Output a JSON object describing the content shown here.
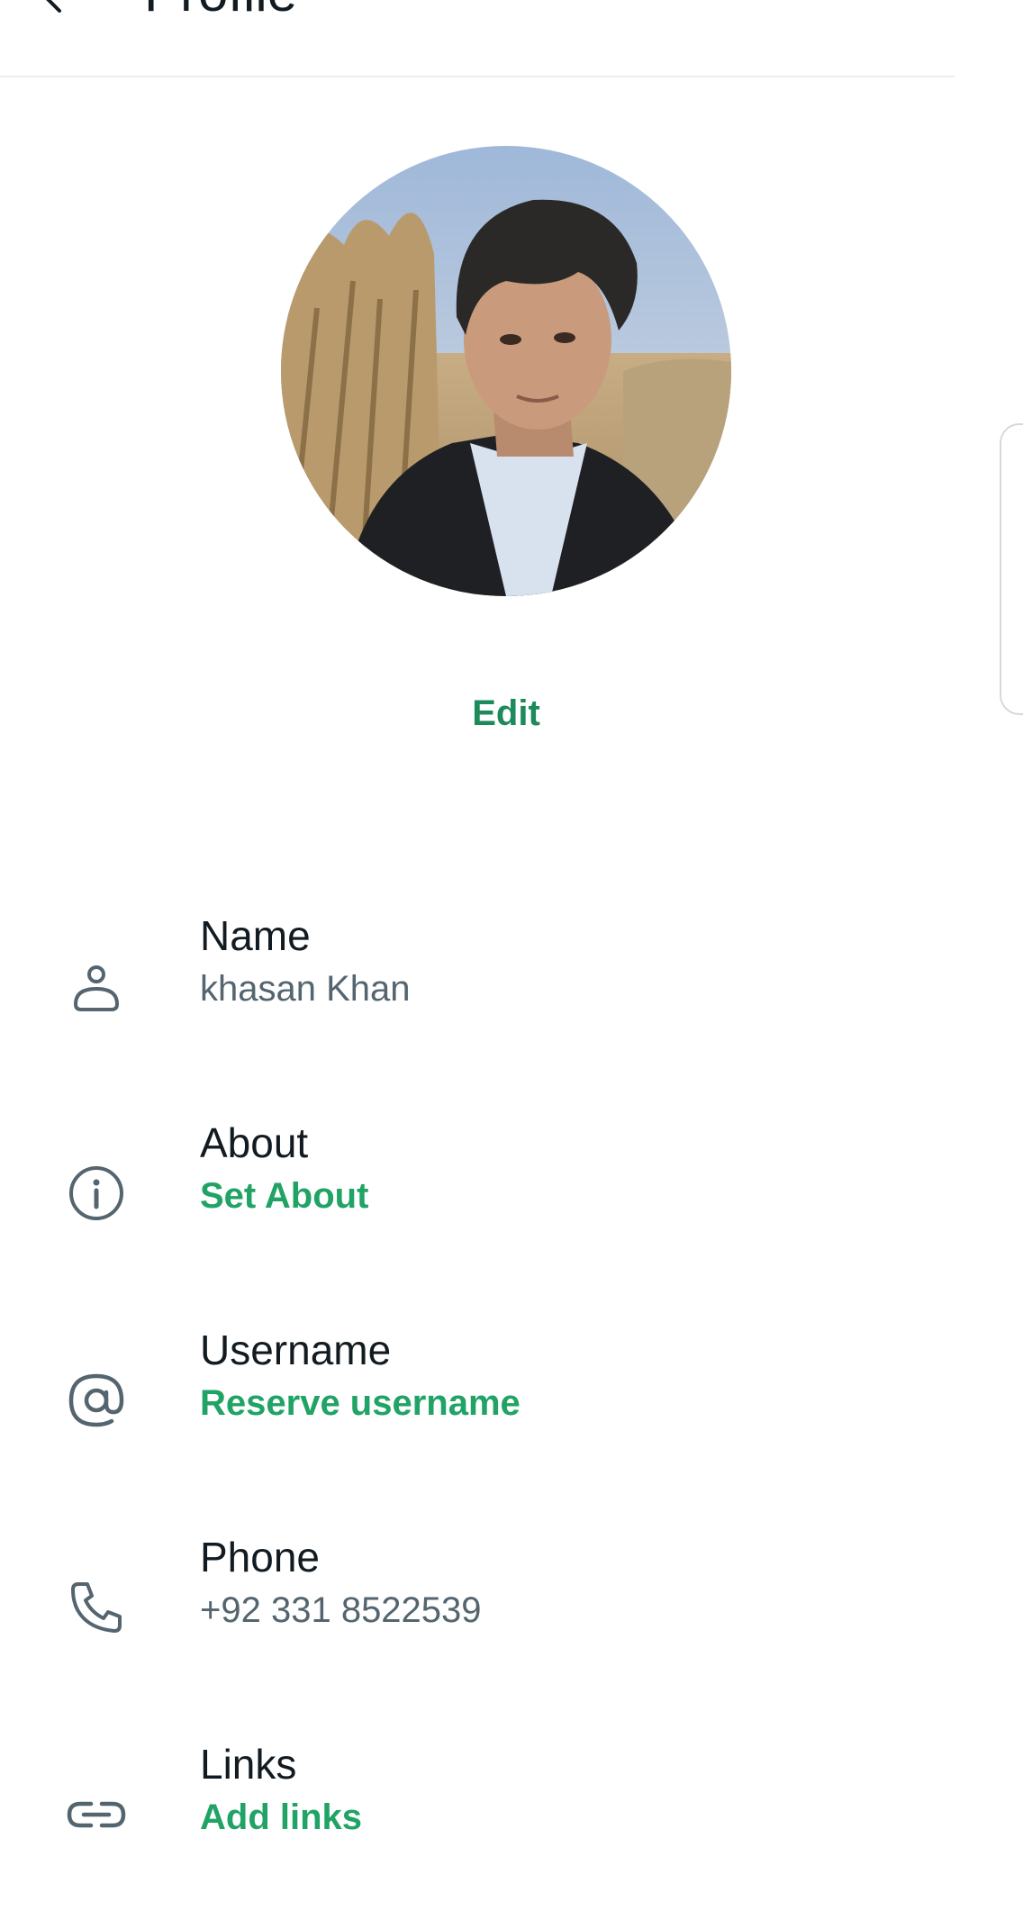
{
  "app_bar": {
    "title": "Profile",
    "back_icon": "arrow-back-icon"
  },
  "avatar": {
    "edit_label": "Edit"
  },
  "rows": [
    {
      "icon": "person-icon",
      "label": "Name",
      "value": "khasan Khan"
    },
    {
      "icon": "info-icon",
      "label": "About",
      "action": "Set About"
    },
    {
      "icon": "at-sign-icon",
      "label": "Username",
      "action": "Reserve username"
    },
    {
      "icon": "phone-icon",
      "label": "Phone",
      "value": "+92 331 8522539"
    },
    {
      "icon": "link-icon",
      "label": "Links",
      "action": "Add links"
    }
  ],
  "colors": {
    "accent": "#1c8a5b",
    "action": "#21a366",
    "primary_text": "#111b21",
    "secondary_text": "#54656f"
  }
}
